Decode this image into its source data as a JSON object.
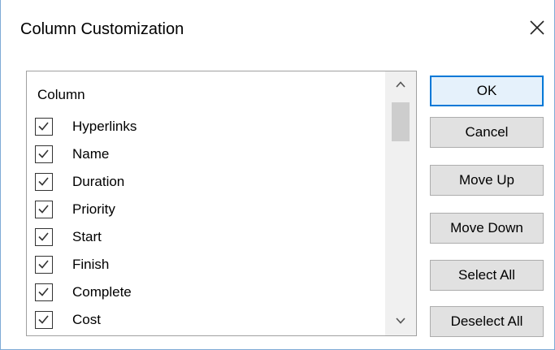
{
  "dialog": {
    "title": "Column Customization",
    "close_icon": "close-icon"
  },
  "list": {
    "header": "Column",
    "items": [
      {
        "label": "Hyperlinks",
        "checked": true
      },
      {
        "label": "Name",
        "checked": true
      },
      {
        "label": "Duration",
        "checked": true
      },
      {
        "label": "Priority",
        "checked": true
      },
      {
        "label": "Start",
        "checked": true
      },
      {
        "label": "Finish",
        "checked": true
      },
      {
        "label": "Complete",
        "checked": true
      },
      {
        "label": "Cost",
        "checked": true
      }
    ],
    "scroll_up_icon": "chevron-up-icon",
    "scroll_down_icon": "chevron-down-icon"
  },
  "buttons": {
    "ok": "OK",
    "cancel": "Cancel",
    "move_up": "Move Up",
    "move_down": "Move Down",
    "select_all": "Select All",
    "deselect_all": "Deselect All"
  },
  "colors": {
    "default_button_border": "#0078d7",
    "default_button_bg": "#e5f1fb",
    "button_bg": "#e1e1e1",
    "window_border": "#7eaad6"
  }
}
